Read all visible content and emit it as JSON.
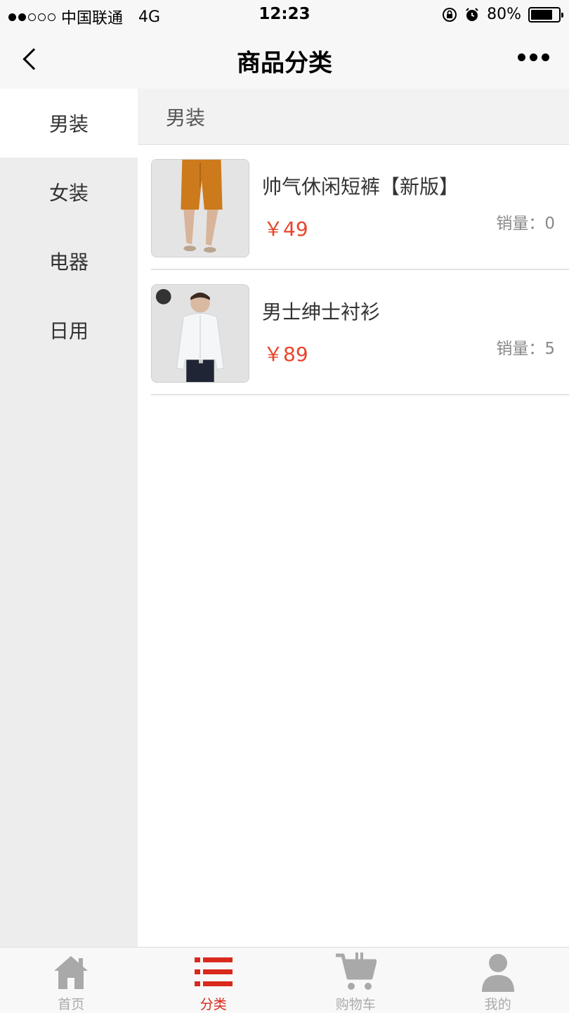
{
  "status_bar": {
    "carrier": "中国联通",
    "network": "4G",
    "time": "12:23",
    "battery": "80%",
    "battery_level": 0.8,
    "signal_bars_filled": 2,
    "signal_bars_total": 5
  },
  "nav": {
    "title": "商品分类",
    "back_icon": "chevron-left-icon",
    "more_icon": "ellipsis-icon"
  },
  "sidebar": {
    "items": [
      {
        "label": "男装",
        "active": true
      },
      {
        "label": "女装",
        "active": false
      },
      {
        "label": "电器",
        "active": false
      },
      {
        "label": "日用",
        "active": false
      }
    ]
  },
  "content": {
    "header": "男装",
    "products": [
      {
        "name": "帅气休闲短裤【新版】",
        "price": "￥49",
        "sales": "销量：0",
        "image_icon": "shorts-product-image"
      },
      {
        "name": "男士绅士衬衫",
        "price": "￥89",
        "sales": "销量：5",
        "image_icon": "shirt-product-image"
      }
    ]
  },
  "tab_bar": {
    "items": [
      {
        "label": "首页",
        "icon": "home-icon",
        "active": false
      },
      {
        "label": "分类",
        "icon": "list-icon",
        "active": true
      },
      {
        "label": "购物车",
        "icon": "cart-icon",
        "active": false
      },
      {
        "label": "我的",
        "icon": "user-icon",
        "active": false
      }
    ]
  },
  "colors": {
    "accent": "#d9291c",
    "price": "#e8452a",
    "sidebar_bg": "#ededed",
    "inactive_tab": "#aaaaaa"
  }
}
